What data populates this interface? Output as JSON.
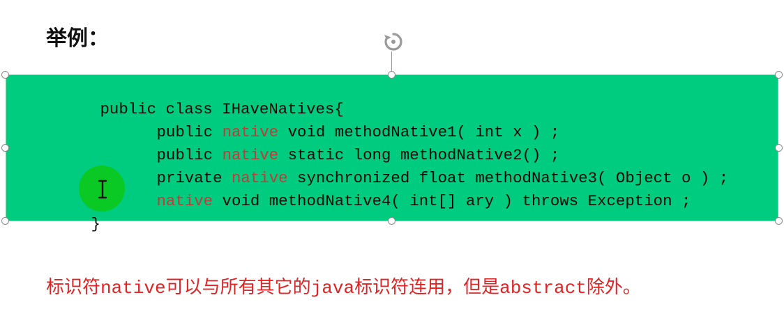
{
  "slide": {
    "heading": "举例：",
    "code": {
      "line1": "public class IHaveNatives{",
      "line2_pre": "public ",
      "line2_kw": "native",
      "line2_post": " void methodNative1( int x ) ;",
      "line3_pre": "public ",
      "line3_kw": "native",
      "line3_post": " static long methodNative2() ;",
      "line4_pre": "private ",
      "line4_kw": "native",
      "line4_post": " synchronized float methodNative3( Object o ) ;",
      "line5_kw": "native",
      "line5_post": " void methodNative4( int[] ary ) throws Exception ;",
      "line6": "}"
    },
    "note": {
      "part1": "标识符",
      "part2": "native",
      "part3": "可以与所有其它的",
      "part4": "java",
      "part5": "标识符连用，但是",
      "part6": "abstract",
      "part7": "除外。"
    }
  },
  "colors": {
    "code_background": "#00cc7f",
    "keyword": "#c33a3a",
    "note_text": "#e02424",
    "cursor_highlight": "#0cc814"
  },
  "icons": {
    "rotate": "rotate-handle-icon",
    "cursor": "text-cursor-ibeam-icon"
  }
}
